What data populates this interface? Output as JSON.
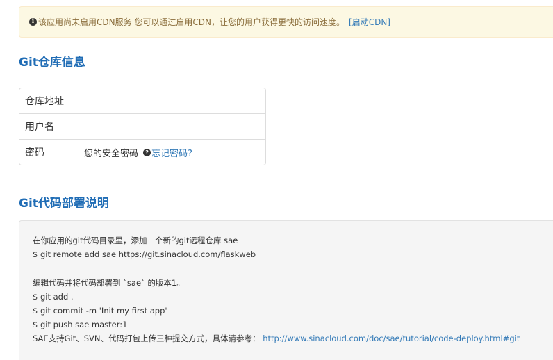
{
  "alert": {
    "icon": "info-circle-icon",
    "message": "该应用尚未启用CDN服务 您可以通过启用CDN，让您的用户获得更快的访问速度。",
    "link_label": "[启动CDN]"
  },
  "repo_section": {
    "title": "Git仓库信息",
    "rows": [
      {
        "key": "仓库地址",
        "value": ""
      },
      {
        "key": "用户名",
        "value": ""
      },
      {
        "key": "密码",
        "value": "您的安全密码"
      }
    ],
    "help_icon": "question-circle-icon",
    "forgot_label": "忘记密码?"
  },
  "deploy_section": {
    "title": "Git代码部署说明",
    "lines": [
      "在你应用的git代码目录里，添加一个新的git远程仓库 sae",
      "$ git remote add sae https://git.sinacloud.com/flaskweb",
      "编辑代码并将代码部署到 `sae` 的版本1。",
      "$ git add .",
      "$ git commit -m 'Init my first app'",
      "$ git push sae master:1"
    ],
    "ref_text": "SAE支持Git、SVN、代码打包上传三种提交方式，具体请参考：",
    "ref_link": "http://www.sinacloud.com/doc/sae/tutorial/code-deploy.html#git"
  }
}
